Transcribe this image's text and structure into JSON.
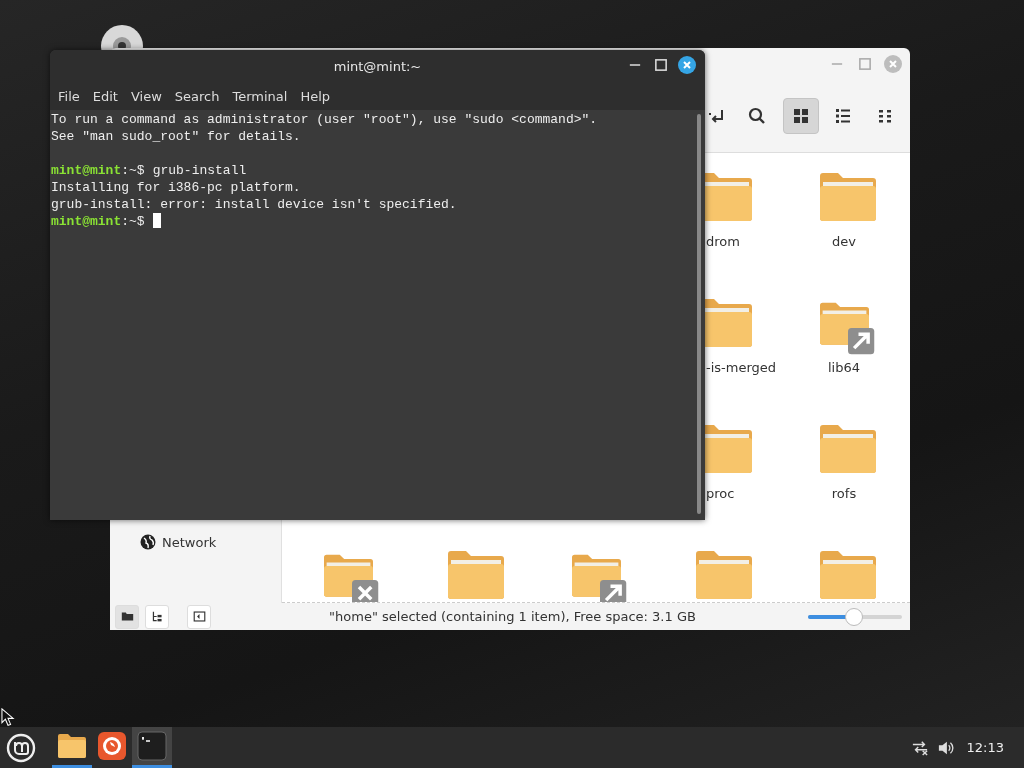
{
  "file_manager": {
    "view_modes": [
      {
        "kind": "grid",
        "selected": true
      },
      {
        "kind": "list",
        "selected": false
      },
      {
        "kind": "compact",
        "selected": false
      }
    ],
    "sidebar": {
      "items": [
        {
          "label": "Network"
        }
      ]
    },
    "folder_rows": [
      {
        "items": [
          {
            "kind": "folder",
            "label": "drom"
          },
          {
            "kind": "folder",
            "label": "dev"
          }
        ]
      },
      {
        "items": [
          {
            "kind": "folder",
            "label": "-is-merged"
          },
          {
            "kind": "folder",
            "label": "lib64",
            "symlink": true
          }
        ]
      },
      {
        "items": [
          {
            "kind": "folder",
            "label": "proc"
          },
          {
            "kind": "folder",
            "label": "rofs"
          }
        ]
      },
      {
        "items": [
          {
            "kind": "folder",
            "unreadable": true
          },
          {
            "kind": "folder"
          },
          {
            "kind": "folder",
            "symlink": true
          },
          {
            "kind": "folder"
          },
          {
            "kind": "folder"
          }
        ]
      }
    ],
    "status_bar": {
      "pane_buttons": [
        {
          "kind": "places",
          "selected": true
        },
        {
          "kind": "tree",
          "selected": false
        }
      ],
      "text": "\"home\" selected (containing 1 item), Free space: 3.1 GB",
      "zoom": {
        "level": 0.48
      }
    }
  },
  "terminal": {
    "title": "mint@mint:~",
    "menu": [
      "File",
      "Edit",
      "View",
      "Search",
      "Terminal",
      "Help"
    ],
    "lines": [
      {
        "kind": "output",
        "text": "To run a command as administrator (user \"root\"), use \"sudo <command>\"."
      },
      {
        "kind": "output",
        "text": "See \"man sudo_root\" for details."
      },
      {
        "kind": "blank"
      },
      {
        "kind": "prompt",
        "user": "mint@mint",
        "path": ":~$",
        "text": "grub-install"
      },
      {
        "kind": "output",
        "text": "Installing for i386-pc platform."
      },
      {
        "kind": "output",
        "text": "grub-install: error: install device isn't specified."
      },
      {
        "kind": "prompt",
        "user": "mint@mint",
        "path": ":~$",
        "cursor": true
      }
    ]
  },
  "taskbar": {
    "launchers": [
      {
        "kind": "files",
        "running": true,
        "selected": false
      },
      {
        "kind": "browser",
        "running": false,
        "selected": false
      },
      {
        "kind": "terminal",
        "running": true,
        "selected": true
      }
    ],
    "clock": "12:13"
  }
}
